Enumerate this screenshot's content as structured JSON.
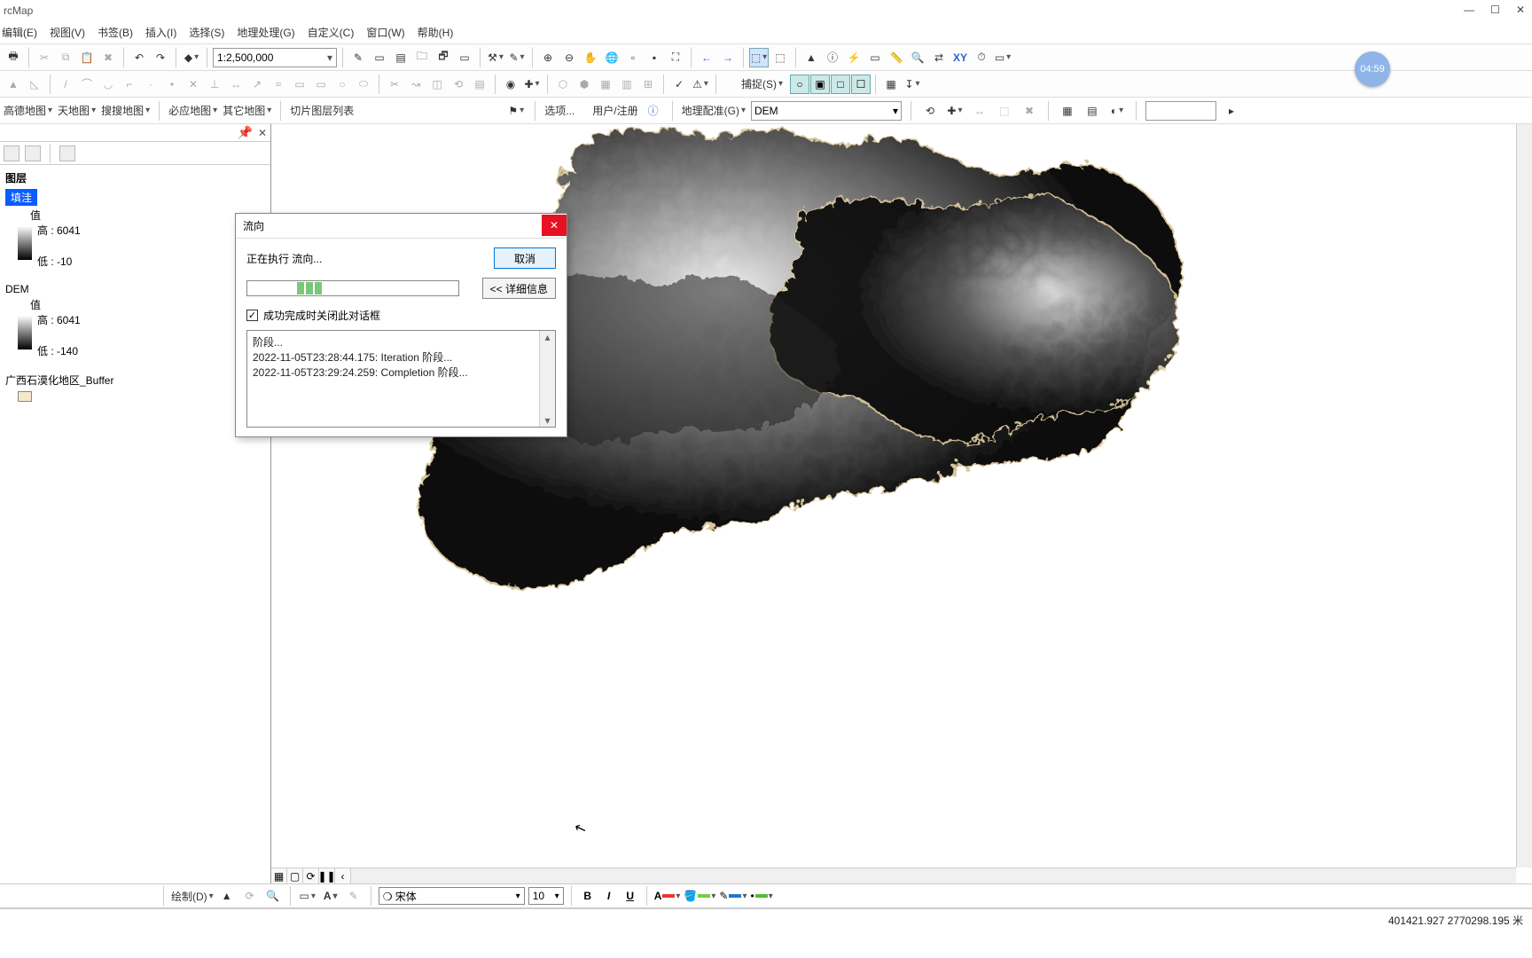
{
  "app_title": "rcMap",
  "menu": [
    "编辑(E)",
    "视图(V)",
    "书签(B)",
    "插入(I)",
    "选择(S)",
    "地理处理(G)",
    "自定义(C)",
    "窗口(W)",
    "帮助(H)"
  ],
  "toolbar1": {
    "scale": "1:2,500,000"
  },
  "snap_label": "捕捉(S)",
  "toolbar_maps": {
    "items": [
      "高德地图",
      "天地图",
      "搜搜地图"
    ],
    "items2": [
      "必应地图",
      "其它地图"
    ],
    "slice": "切片图层列表",
    "options": "选项...",
    "login": "用户/注册",
    "georef": "地理配准(G)",
    "georef_layer": "DEM"
  },
  "toc": {
    "root": "图层",
    "layer1": {
      "name": "填洼",
      "valLabel": "值",
      "high": "高 : 6041",
      "low": "低 : -10"
    },
    "layer2": {
      "name": "DEM",
      "valLabel": "值",
      "high": "高 : 6041",
      "low": "低 : -140"
    },
    "layer3": {
      "name": "广西石漠化地区_Buffer"
    }
  },
  "dialog": {
    "title": "流向",
    "running": "正在执行 流向...",
    "cancel": "取消",
    "details": "<< 详细信息",
    "close_on_done": "成功完成时关闭此对话框",
    "log": "阶段...\n2022-11-05T23:28:44.175: Iteration 阶段...\n2022-11-05T23:29:24.259: Completion 阶段..."
  },
  "draw": {
    "label": "绘制(D)",
    "font": "宋体",
    "size": "10"
  },
  "status": {
    "coords": "401421.927  2770298.195 米"
  },
  "timer": "04:59",
  "map_tabs": {
    "t1": "▦",
    "t2": "▢",
    "t3": "⟳",
    "t4": "❚❚",
    "t5": "‹"
  }
}
